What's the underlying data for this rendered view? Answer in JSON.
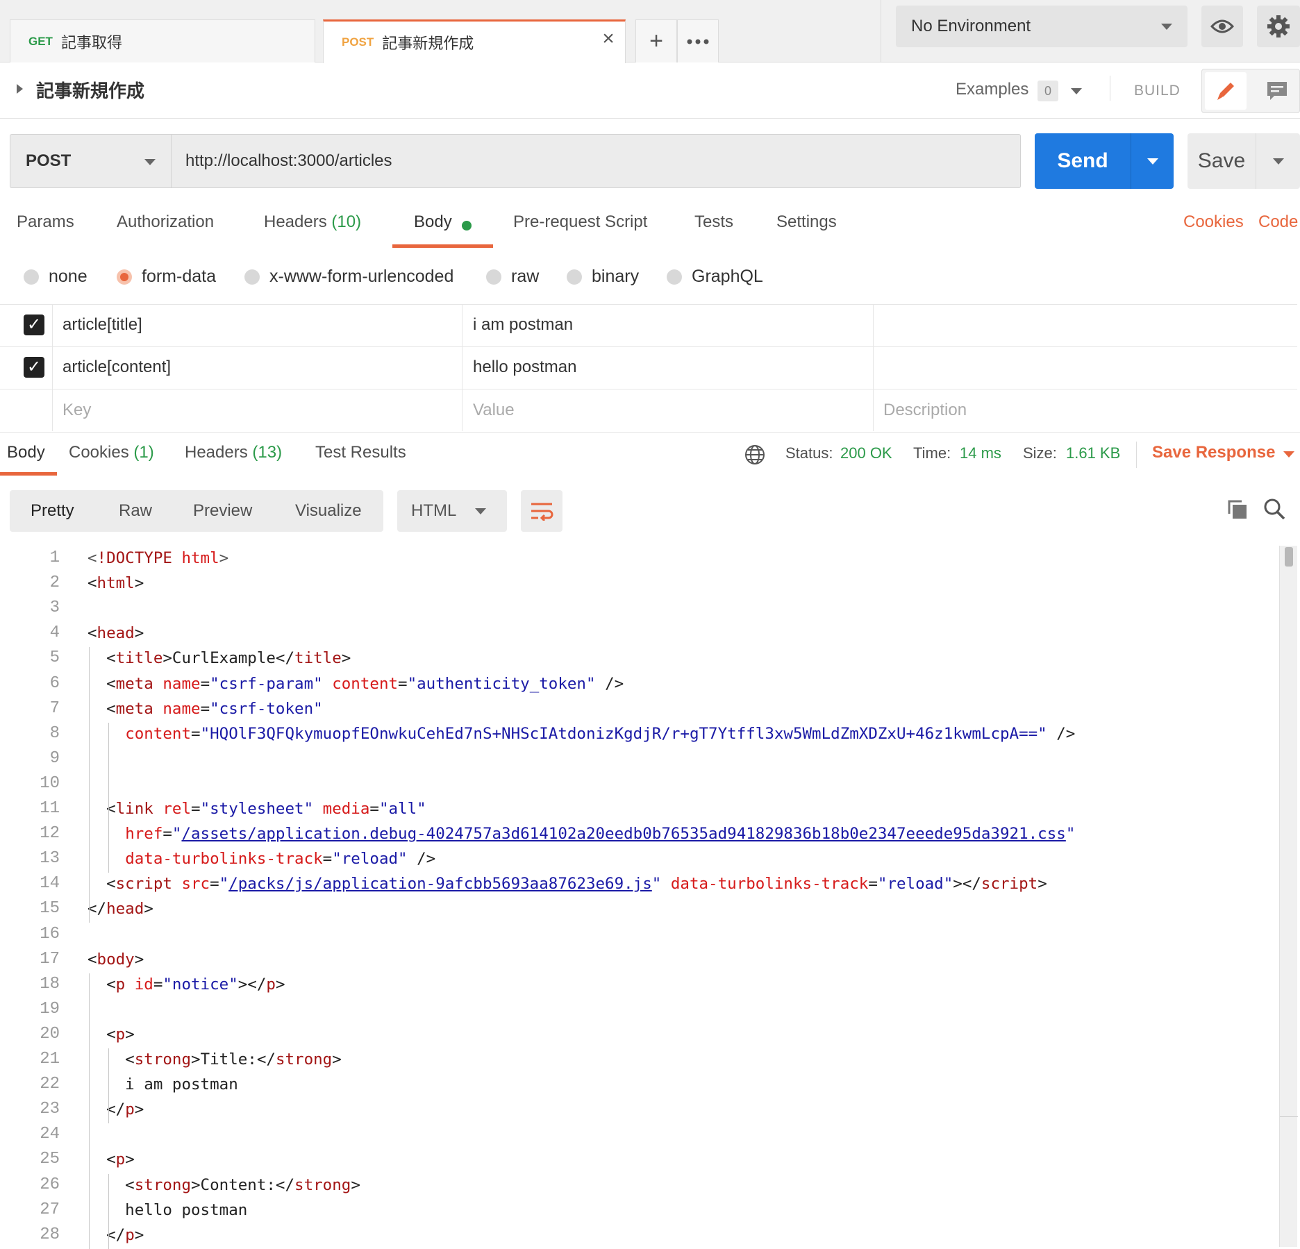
{
  "tabs": [
    {
      "method": "GET",
      "name": "記事取得"
    },
    {
      "method": "POST",
      "name": "記事新規作成"
    }
  ],
  "environment": "No Environment",
  "request": {
    "title": "記事新規作成",
    "examples_label": "Examples",
    "examples_count": "0",
    "mode": "BUILD",
    "method": "POST",
    "url": "http://localhost:3000/articles",
    "send_label": "Send",
    "save_label": "Save"
  },
  "request_tabs": {
    "params": "Params",
    "authorization": "Authorization",
    "headers": "Headers",
    "headers_count": "(10)",
    "body": "Body",
    "prerequest": "Pre-request Script",
    "tests": "Tests",
    "settings": "Settings",
    "cookies": "Cookies",
    "code": "Code"
  },
  "body_types": [
    "none",
    "form-data",
    "x-www-form-urlencoded",
    "raw",
    "binary",
    "GraphQL"
  ],
  "body_type_selected": "form-data",
  "form_data": [
    {
      "key": "article[title]",
      "value": "i am postman",
      "checked": true
    },
    {
      "key": "article[content]",
      "value": "hello postman",
      "checked": true
    }
  ],
  "form_placeholders": {
    "key": "Key",
    "value": "Value",
    "description": "Description"
  },
  "response": {
    "tabs": {
      "body": "Body",
      "cookies": "Cookies",
      "cookies_count": "(1)",
      "headers": "Headers",
      "headers_count": "(13)",
      "tests": "Test Results"
    },
    "status_label": "Status:",
    "status": "200 OK",
    "time_label": "Time:",
    "time": "14 ms",
    "size_label": "Size:",
    "size": "1.61 KB",
    "save_response": "Save Response",
    "views": {
      "pretty": "Pretty",
      "raw": "Raw",
      "preview": "Preview",
      "visualize": "Visualize"
    },
    "format": "HTML"
  },
  "code_lines": [
    {
      "n": "1",
      "parts": [
        [
          "gr",
          "<"
        ],
        [
          "t",
          "!DOCTYPE "
        ],
        [
          "a",
          "html"
        ],
        [
          "gr",
          ">"
        ]
      ]
    },
    {
      "n": "2",
      "parts": [
        [
          "",
          "<"
        ],
        [
          "t",
          "html"
        ],
        [
          "",
          ">"
        ]
      ]
    },
    {
      "n": "3",
      "parts": []
    },
    {
      "n": "4",
      "parts": [
        [
          "",
          "<"
        ],
        [
          "t",
          "head"
        ],
        [
          "",
          ">"
        ]
      ]
    },
    {
      "n": "5",
      "parts": [
        [
          "",
          "  <"
        ],
        [
          "t",
          "title"
        ],
        [
          "",
          ">CurlExample</"
        ],
        [
          "t",
          "title"
        ],
        [
          "",
          ">"
        ]
      ]
    },
    {
      "n": "6",
      "parts": [
        [
          "",
          "  <"
        ],
        [
          "t",
          "meta "
        ],
        [
          "a",
          "name"
        ],
        [
          "",
          "="
        ],
        [
          "s",
          "\"csrf-param\""
        ],
        [
          "",
          " "
        ],
        [
          "a",
          "content"
        ],
        [
          "",
          "="
        ],
        [
          "s",
          "\"authenticity_token\""
        ],
        [
          "",
          " />"
        ]
      ]
    },
    {
      "n": "7",
      "parts": [
        [
          "",
          "  <"
        ],
        [
          "t",
          "meta "
        ],
        [
          "a",
          "name"
        ],
        [
          "",
          "="
        ],
        [
          "s",
          "\"csrf-token\""
        ]
      ]
    },
    {
      "n": "8",
      "parts": [
        [
          "",
          "    "
        ],
        [
          "a",
          "content"
        ],
        [
          "",
          "="
        ],
        [
          "s",
          "\"HQOlF3QFQkymuopfEOnwkuCehEd7nS+NHScIAtdonizKgdjR/r+gT7Ytffl3xw5WmLdZmXDZxU+46z1kwmLcpA==\""
        ],
        [
          "",
          " />"
        ]
      ]
    },
    {
      "n": "9",
      "parts": []
    },
    {
      "n": "10",
      "parts": []
    },
    {
      "n": "11",
      "parts": [
        [
          "",
          "  <"
        ],
        [
          "t",
          "link "
        ],
        [
          "a",
          "rel"
        ],
        [
          "",
          "="
        ],
        [
          "s",
          "\"stylesheet\""
        ],
        [
          "",
          " "
        ],
        [
          "a",
          "media"
        ],
        [
          "",
          "="
        ],
        [
          "s",
          "\"all\""
        ]
      ]
    },
    {
      "n": "12",
      "parts": [
        [
          "",
          "    "
        ],
        [
          "a",
          "href"
        ],
        [
          "",
          "="
        ],
        [
          "s",
          "\""
        ],
        [
          "u",
          "/assets/application.debug-4024757a3d614102a20eedb0b76535ad941829836b18b0e2347eeede95da3921.css"
        ],
        [
          "s",
          "\""
        ]
      ]
    },
    {
      "n": "13",
      "parts": [
        [
          "",
          "    "
        ],
        [
          "a",
          "data-turbolinks-track"
        ],
        [
          "",
          "="
        ],
        [
          "s",
          "\"reload\""
        ],
        [
          "",
          " />"
        ]
      ]
    },
    {
      "n": "14",
      "parts": [
        [
          "",
          "  <"
        ],
        [
          "t",
          "script "
        ],
        [
          "a",
          "src"
        ],
        [
          "",
          "="
        ],
        [
          "s",
          "\""
        ],
        [
          "u",
          "/packs/js/application-9afcbb5693aa87623e69.js"
        ],
        [
          "s",
          "\""
        ],
        [
          "",
          " "
        ],
        [
          "a",
          "data-turbolinks-track"
        ],
        [
          "",
          "="
        ],
        [
          "s",
          "\"reload\""
        ],
        [
          "",
          "></"
        ],
        [
          "t",
          "script"
        ],
        [
          "",
          ">"
        ]
      ]
    },
    {
      "n": "15",
      "parts": [
        [
          "",
          "</"
        ],
        [
          "t",
          "head"
        ],
        [
          "",
          ">"
        ]
      ]
    },
    {
      "n": "16",
      "parts": []
    },
    {
      "n": "17",
      "parts": [
        [
          "",
          "<"
        ],
        [
          "t",
          "body"
        ],
        [
          "",
          ">"
        ]
      ]
    },
    {
      "n": "18",
      "parts": [
        [
          "",
          "  <"
        ],
        [
          "t",
          "p "
        ],
        [
          "a",
          "id"
        ],
        [
          "",
          "="
        ],
        [
          "s",
          "\"notice\""
        ],
        [
          "",
          "></"
        ],
        [
          "t",
          "p"
        ],
        [
          "",
          ">"
        ]
      ]
    },
    {
      "n": "19",
      "parts": []
    },
    {
      "n": "20",
      "parts": [
        [
          "",
          "  <"
        ],
        [
          "t",
          "p"
        ],
        [
          "",
          ">"
        ]
      ]
    },
    {
      "n": "21",
      "parts": [
        [
          "",
          "    <"
        ],
        [
          "t",
          "strong"
        ],
        [
          "",
          ">Title:</"
        ],
        [
          "t",
          "strong"
        ],
        [
          "",
          ">"
        ]
      ]
    },
    {
      "n": "22",
      "parts": [
        [
          "",
          "    i am postman"
        ]
      ]
    },
    {
      "n": "23",
      "parts": [
        [
          "",
          "  </"
        ],
        [
          "t",
          "p"
        ],
        [
          "",
          ">"
        ]
      ]
    },
    {
      "n": "24",
      "parts": []
    },
    {
      "n": "25",
      "parts": [
        [
          "",
          "  <"
        ],
        [
          "t",
          "p"
        ],
        [
          "",
          ">"
        ]
      ]
    },
    {
      "n": "26",
      "parts": [
        [
          "",
          "    <"
        ],
        [
          "t",
          "strong"
        ],
        [
          "",
          ">Content:</"
        ],
        [
          "t",
          "strong"
        ],
        [
          "",
          ">"
        ]
      ]
    },
    {
      "n": "27",
      "parts": [
        [
          "",
          "    hello postman"
        ]
      ]
    },
    {
      "n": "28",
      "parts": [
        [
          "",
          "  </"
        ],
        [
          "t",
          "p"
        ],
        [
          "",
          ">"
        ]
      ]
    }
  ],
  "colors": {
    "accent": "#e8663d",
    "send": "#1f7ae0",
    "success": "#2b9a49"
  }
}
